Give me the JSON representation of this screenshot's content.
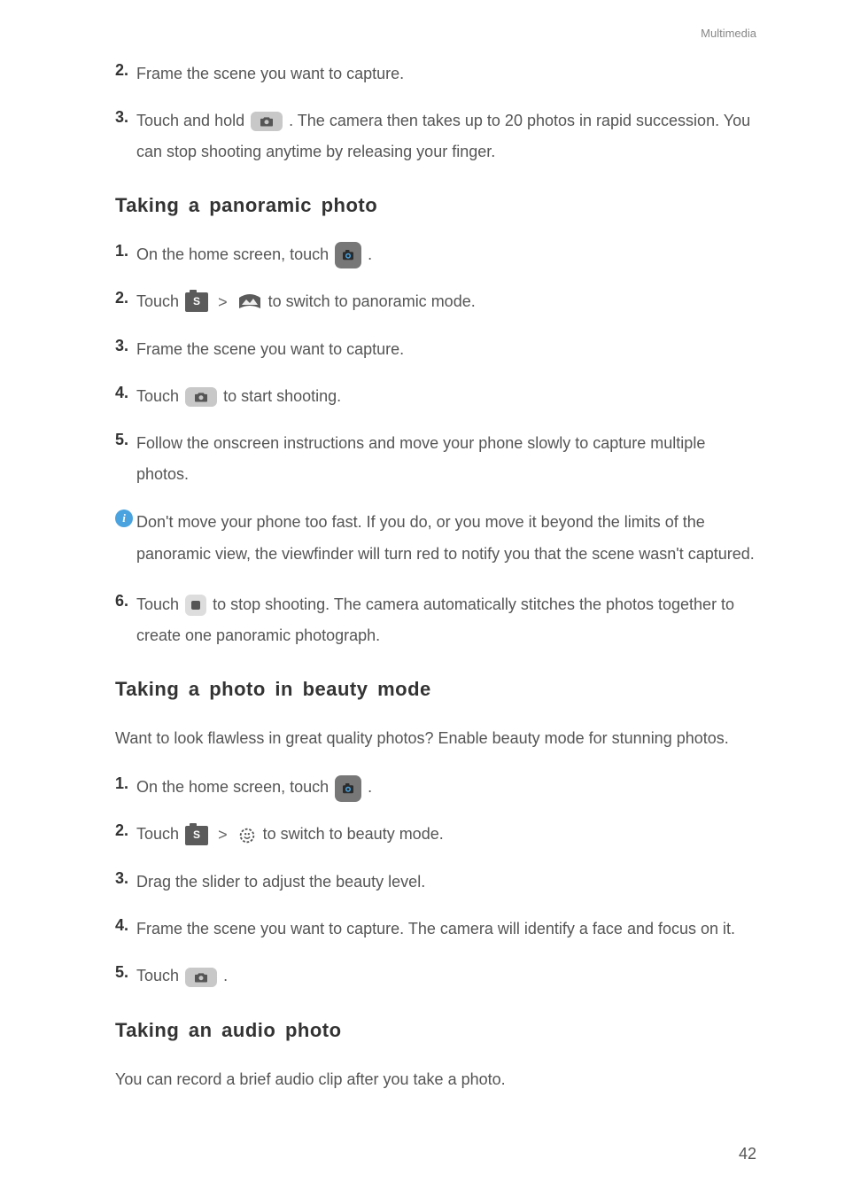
{
  "header": {
    "section": "Multimedia"
  },
  "footer": {
    "page": "42"
  },
  "burst": {
    "step2": {
      "num": "2.",
      "text": "Frame the scene you want to capture."
    },
    "step3": {
      "num": "3.",
      "before": "Touch and hold ",
      "after": " . The camera then takes up to 20 photos in rapid succession. You can stop shooting anytime by releasing your finger."
    }
  },
  "pano": {
    "heading": "Taking a panoramic photo",
    "step1": {
      "num": "1.",
      "before": "On the home screen, touch ",
      "after": " ."
    },
    "step2": {
      "num": "2.",
      "before": "Touch ",
      "after": "to switch to panoramic mode."
    },
    "step3": {
      "num": "3.",
      "text": "Frame the scene you want to capture."
    },
    "step4": {
      "num": "4.",
      "before": "Touch ",
      "after": " to start shooting."
    },
    "step5": {
      "num": "5.",
      "text": "Follow the onscreen instructions and move your phone slowly to capture multiple photos."
    },
    "info": "Don't move your phone too fast. If you do, or you move it beyond the limits of the panoramic view, the viewfinder will turn red to notify you that the scene wasn't captured.",
    "step6": {
      "num": "6.",
      "before": "Touch ",
      "after": " to stop shooting. The camera automatically stitches the photos together to create one panoramic photograph."
    }
  },
  "beauty": {
    "heading": "Taking a photo in beauty mode",
    "lead": "Want to look flawless in great quality photos? Enable beauty mode for stunning photos.",
    "step1": {
      "num": "1.",
      "before": "On the home screen, touch ",
      "after": " ."
    },
    "step2": {
      "num": "2.",
      "before": "Touch ",
      "after": " to switch to beauty mode."
    },
    "step3": {
      "num": "3.",
      "text": "Drag the slider to adjust the beauty level."
    },
    "step4": {
      "num": "4.",
      "text": "Frame the scene you want to capture. The camera will identify a face and focus on it."
    },
    "step5": {
      "num": "5.",
      "before": "Touch ",
      "after": " ."
    }
  },
  "audio": {
    "heading": "Taking an audio photo",
    "lead": "You can record a brief audio clip after you take a photo."
  },
  "icons": {
    "s_label": "S"
  }
}
